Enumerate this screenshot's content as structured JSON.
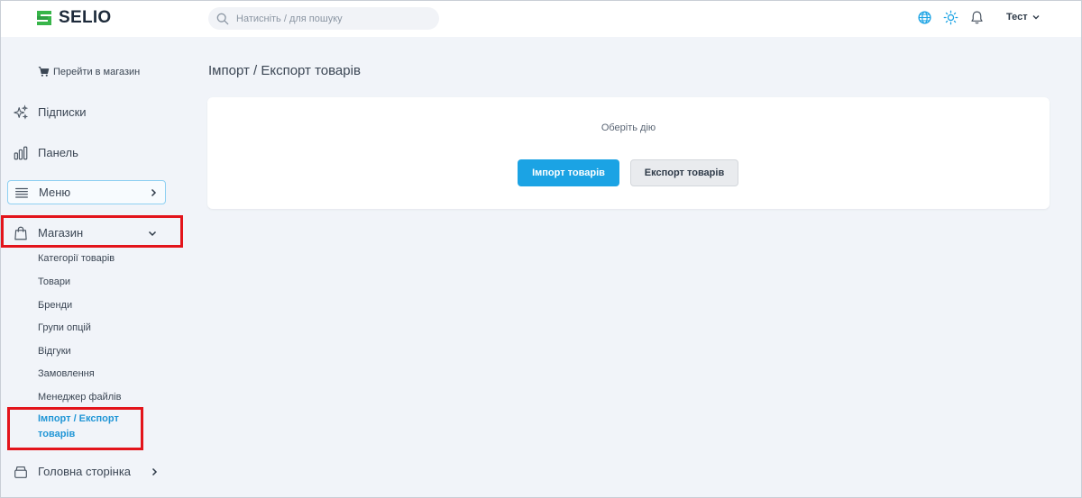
{
  "header": {
    "logo_text": "SELIO",
    "search_placeholder": "Натисніть / для пошуку",
    "user_name": "Тест",
    "icons": [
      "globe-icon",
      "sun-icon",
      "bell-icon"
    ]
  },
  "sidebar": {
    "goto_shop": "Перейти в магазин",
    "items": [
      {
        "label": "Підписки",
        "icon": "sparkles-icon"
      },
      {
        "label": "Панель",
        "icon": "bar-chart-icon"
      },
      {
        "label": "Меню",
        "icon": "list-icon"
      },
      {
        "label": "Магазин",
        "icon": "shopping-bag-icon"
      },
      {
        "label": "Головна сторінка",
        "icon": "box-icon"
      }
    ],
    "shop_sub_items": [
      "Категорії товарів",
      "Товари",
      "Бренди",
      "Групи опцій",
      "Відгуки",
      "Замовлення",
      "Менеджер файлів"
    ],
    "active_sub_item_line1": "Імпорт / Експорт",
    "active_sub_item_line2": "товарів"
  },
  "main": {
    "title": "Імпорт / Експорт товарів",
    "caption": "Оберіть дію",
    "import_button": "Імпорт товарів",
    "export_button": "Експорт товарів"
  },
  "colors": {
    "accent": "#1ba3e4",
    "highlight": "#e3141b",
    "logo_green": "#38b54a"
  }
}
